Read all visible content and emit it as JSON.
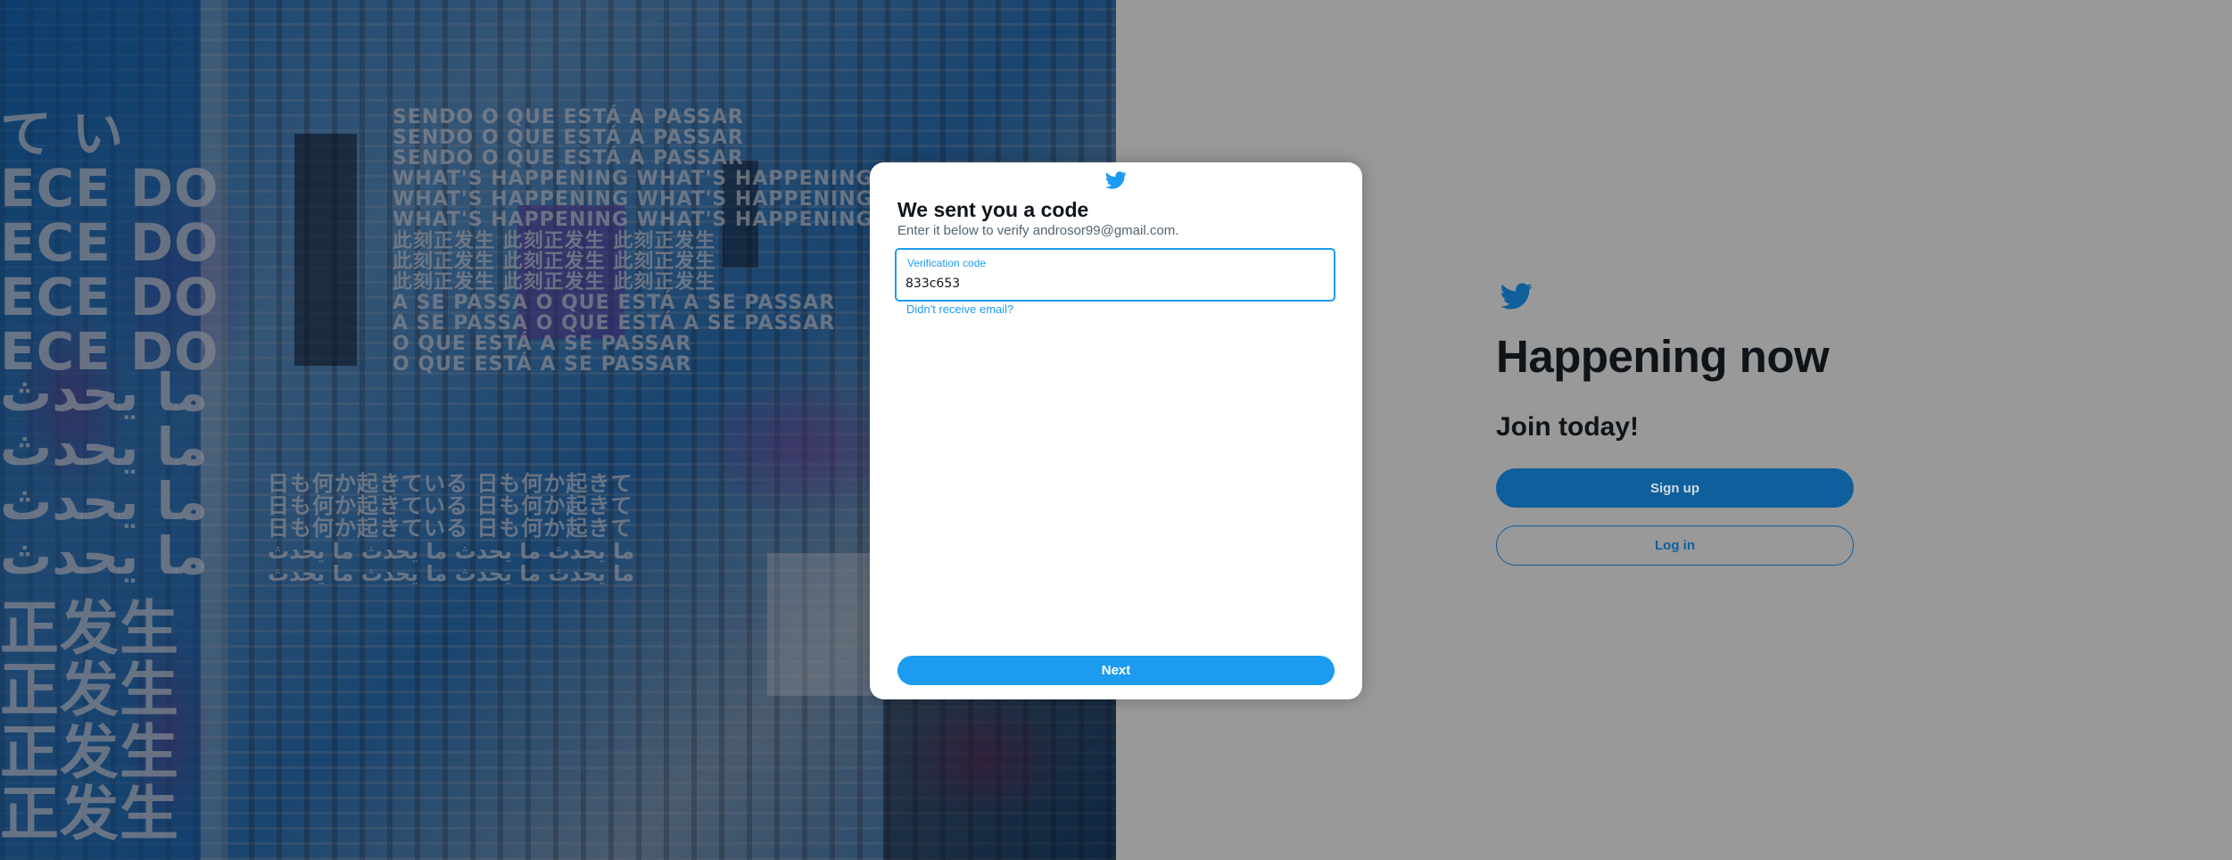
{
  "colors": {
    "brand_blue": "#1d9bf0",
    "dim_blue": "#0f5f9c",
    "backdrop": "#999999",
    "text_primary": "#0f1419",
    "text_secondary": "#536471"
  },
  "hero": {
    "icon": "twitter-hero-art"
  },
  "landing": {
    "logo_icon": "twitter-bird-icon",
    "headline": "Happening now",
    "join": "Join today!",
    "signup_label": "Sign up",
    "login_label": "Log in"
  },
  "modal": {
    "logo_icon": "twitter-bird-icon",
    "title": "We sent you a code",
    "subtitle": "Enter it below to verify androsor99@gmail.com.",
    "field": {
      "label": "Verification code",
      "value": "833c653"
    },
    "resend_link": "Didn't receive email?",
    "next_label": "Next"
  }
}
